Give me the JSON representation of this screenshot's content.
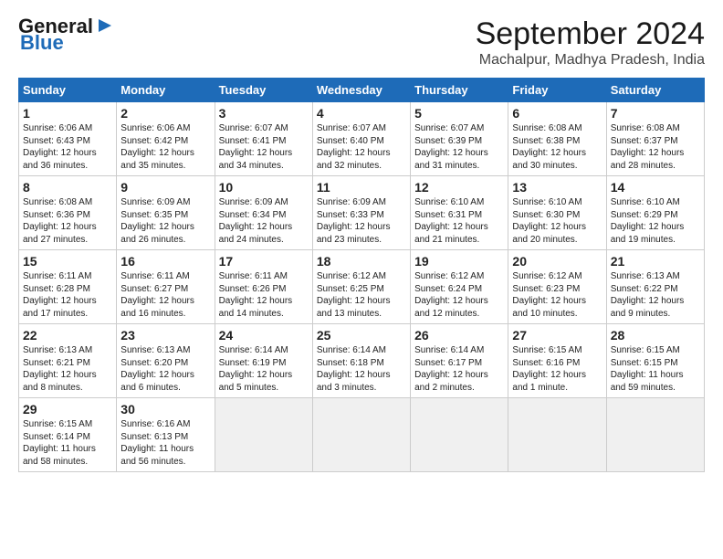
{
  "header": {
    "logo_general": "General",
    "logo_blue": "Blue",
    "month_title": "September 2024",
    "location": "Machalpur, Madhya Pradesh, India"
  },
  "days_of_week": [
    "Sunday",
    "Monday",
    "Tuesday",
    "Wednesday",
    "Thursday",
    "Friday",
    "Saturday"
  ],
  "weeks": [
    [
      {
        "num": "1",
        "info": "Sunrise: 6:06 AM\nSunset: 6:43 PM\nDaylight: 12 hours\nand 36 minutes."
      },
      {
        "num": "2",
        "info": "Sunrise: 6:06 AM\nSunset: 6:42 PM\nDaylight: 12 hours\nand 35 minutes."
      },
      {
        "num": "3",
        "info": "Sunrise: 6:07 AM\nSunset: 6:41 PM\nDaylight: 12 hours\nand 34 minutes."
      },
      {
        "num": "4",
        "info": "Sunrise: 6:07 AM\nSunset: 6:40 PM\nDaylight: 12 hours\nand 32 minutes."
      },
      {
        "num": "5",
        "info": "Sunrise: 6:07 AM\nSunset: 6:39 PM\nDaylight: 12 hours\nand 31 minutes."
      },
      {
        "num": "6",
        "info": "Sunrise: 6:08 AM\nSunset: 6:38 PM\nDaylight: 12 hours\nand 30 minutes."
      },
      {
        "num": "7",
        "info": "Sunrise: 6:08 AM\nSunset: 6:37 PM\nDaylight: 12 hours\nand 28 minutes."
      }
    ],
    [
      {
        "num": "8",
        "info": "Sunrise: 6:08 AM\nSunset: 6:36 PM\nDaylight: 12 hours\nand 27 minutes."
      },
      {
        "num": "9",
        "info": "Sunrise: 6:09 AM\nSunset: 6:35 PM\nDaylight: 12 hours\nand 26 minutes."
      },
      {
        "num": "10",
        "info": "Sunrise: 6:09 AM\nSunset: 6:34 PM\nDaylight: 12 hours\nand 24 minutes."
      },
      {
        "num": "11",
        "info": "Sunrise: 6:09 AM\nSunset: 6:33 PM\nDaylight: 12 hours\nand 23 minutes."
      },
      {
        "num": "12",
        "info": "Sunrise: 6:10 AM\nSunset: 6:31 PM\nDaylight: 12 hours\nand 21 minutes."
      },
      {
        "num": "13",
        "info": "Sunrise: 6:10 AM\nSunset: 6:30 PM\nDaylight: 12 hours\nand 20 minutes."
      },
      {
        "num": "14",
        "info": "Sunrise: 6:10 AM\nSunset: 6:29 PM\nDaylight: 12 hours\nand 19 minutes."
      }
    ],
    [
      {
        "num": "15",
        "info": "Sunrise: 6:11 AM\nSunset: 6:28 PM\nDaylight: 12 hours\nand 17 minutes."
      },
      {
        "num": "16",
        "info": "Sunrise: 6:11 AM\nSunset: 6:27 PM\nDaylight: 12 hours\nand 16 minutes."
      },
      {
        "num": "17",
        "info": "Sunrise: 6:11 AM\nSunset: 6:26 PM\nDaylight: 12 hours\nand 14 minutes."
      },
      {
        "num": "18",
        "info": "Sunrise: 6:12 AM\nSunset: 6:25 PM\nDaylight: 12 hours\nand 13 minutes."
      },
      {
        "num": "19",
        "info": "Sunrise: 6:12 AM\nSunset: 6:24 PM\nDaylight: 12 hours\nand 12 minutes."
      },
      {
        "num": "20",
        "info": "Sunrise: 6:12 AM\nSunset: 6:23 PM\nDaylight: 12 hours\nand 10 minutes."
      },
      {
        "num": "21",
        "info": "Sunrise: 6:13 AM\nSunset: 6:22 PM\nDaylight: 12 hours\nand 9 minutes."
      }
    ],
    [
      {
        "num": "22",
        "info": "Sunrise: 6:13 AM\nSunset: 6:21 PM\nDaylight: 12 hours\nand 8 minutes."
      },
      {
        "num": "23",
        "info": "Sunrise: 6:13 AM\nSunset: 6:20 PM\nDaylight: 12 hours\nand 6 minutes."
      },
      {
        "num": "24",
        "info": "Sunrise: 6:14 AM\nSunset: 6:19 PM\nDaylight: 12 hours\nand 5 minutes."
      },
      {
        "num": "25",
        "info": "Sunrise: 6:14 AM\nSunset: 6:18 PM\nDaylight: 12 hours\nand 3 minutes."
      },
      {
        "num": "26",
        "info": "Sunrise: 6:14 AM\nSunset: 6:17 PM\nDaylight: 12 hours\nand 2 minutes."
      },
      {
        "num": "27",
        "info": "Sunrise: 6:15 AM\nSunset: 6:16 PM\nDaylight: 12 hours\nand 1 minute."
      },
      {
        "num": "28",
        "info": "Sunrise: 6:15 AM\nSunset: 6:15 PM\nDaylight: 11 hours\nand 59 minutes."
      }
    ],
    [
      {
        "num": "29",
        "info": "Sunrise: 6:15 AM\nSunset: 6:14 PM\nDaylight: 11 hours\nand 58 minutes."
      },
      {
        "num": "30",
        "info": "Sunrise: 6:16 AM\nSunset: 6:13 PM\nDaylight: 11 hours\nand 56 minutes."
      },
      {
        "num": "",
        "info": ""
      },
      {
        "num": "",
        "info": ""
      },
      {
        "num": "",
        "info": ""
      },
      {
        "num": "",
        "info": ""
      },
      {
        "num": "",
        "info": ""
      }
    ]
  ]
}
